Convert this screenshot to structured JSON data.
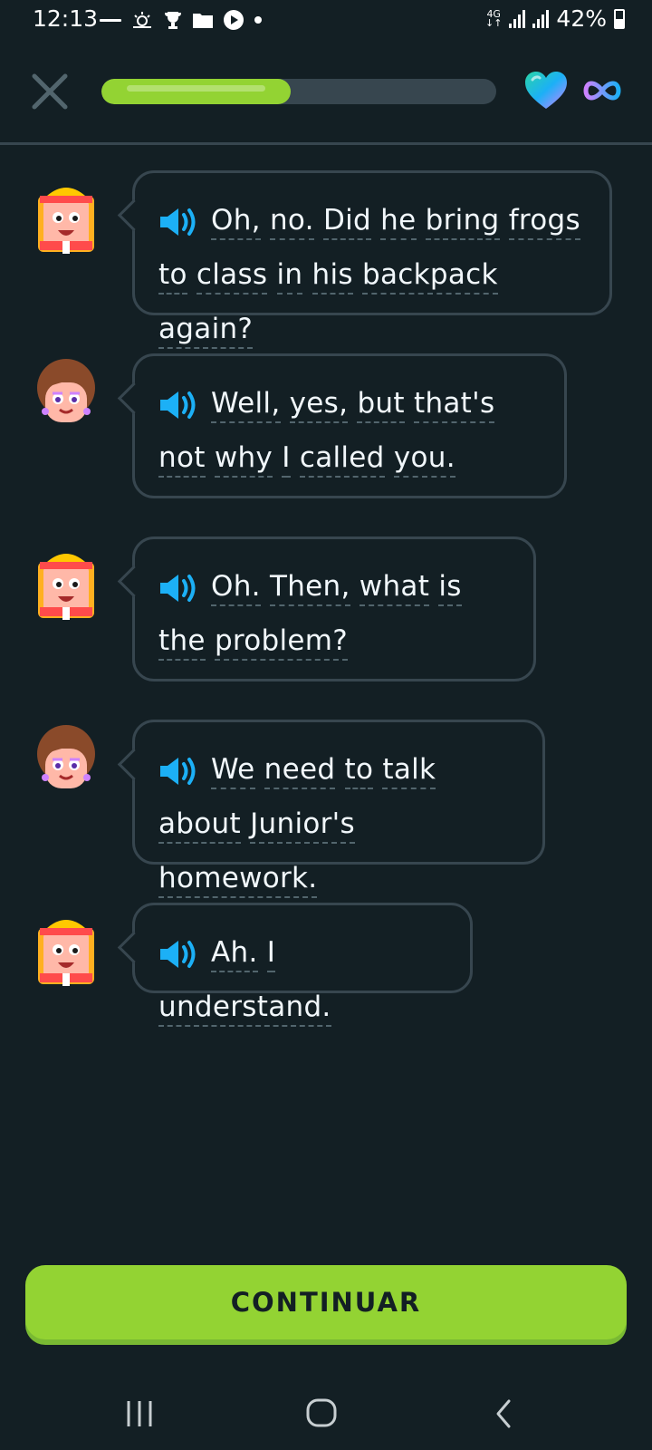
{
  "status_bar": {
    "time": "12:13",
    "network": "4G",
    "battery": "42%"
  },
  "header": {
    "progress": 0.48,
    "hearts": "infinite"
  },
  "messages": [
    {
      "speaker": "lin",
      "words": [
        "Oh,",
        "no.",
        "Did",
        "he",
        "bring",
        "frogs",
        "to",
        "class",
        "in",
        "his",
        "backpack",
        "again?"
      ]
    },
    {
      "speaker": "bea",
      "words": [
        "Well,",
        "yes,",
        "but",
        "that's",
        "not",
        "why",
        "I",
        "called",
        "you."
      ]
    },
    {
      "speaker": "lin",
      "words": [
        "Oh.",
        "Then,",
        "what",
        "is",
        "the",
        "problem?"
      ]
    },
    {
      "speaker": "bea",
      "words": [
        "We",
        "need",
        "to",
        "talk",
        "about",
        "Junior's",
        "homework."
      ]
    },
    {
      "speaker": "lin",
      "words": [
        "Ah.",
        "I",
        "understand."
      ]
    }
  ],
  "footer": {
    "continue_label": "CONTINUAR"
  },
  "colors": {
    "background": "#131f24",
    "accent_green": "#93d333",
    "border": "#37464f",
    "speaker_blue": "#1cb0f6"
  }
}
